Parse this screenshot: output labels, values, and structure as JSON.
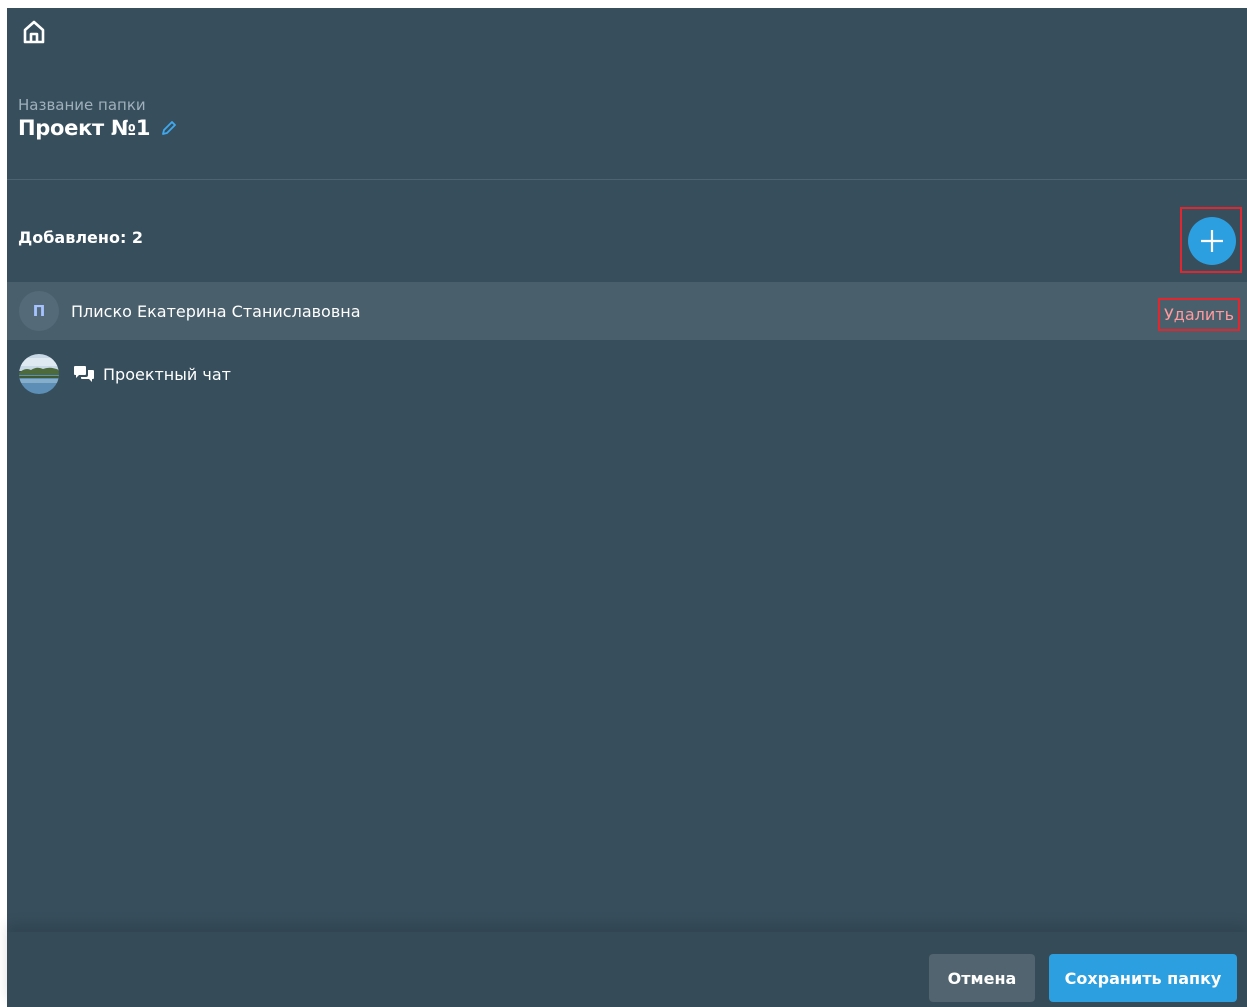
{
  "header": {
    "home_icon": "home-icon"
  },
  "folder": {
    "label": "Название папки",
    "name": "Проект №1",
    "edit_icon": "pencil-icon"
  },
  "members": {
    "count_label": "Добавлено: 2",
    "add_icon": "plus-icon",
    "items": [
      {
        "avatar_letter": "П",
        "name": "Плиско Екатерина Станиславовна",
        "delete_label": "Удалить"
      },
      {
        "avatar": "lake-landscape-photo",
        "type_icon": "chat-icon",
        "name": "Проектный чат"
      }
    ]
  },
  "footer": {
    "cancel_label": "Отмена",
    "save_label": "Сохранить папку"
  },
  "colors": {
    "background": "#374e5c",
    "accent": "#2b9fe0",
    "selected_row": "#4a5f6c",
    "highlight_border": "#e0262f"
  }
}
